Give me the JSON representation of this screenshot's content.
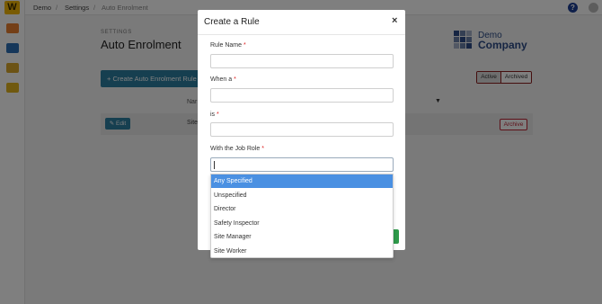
{
  "app": {
    "logo_letter": "W"
  },
  "breadcrumb": {
    "items": [
      "Demo",
      "Settings",
      "Auto Enrolment"
    ],
    "separator": "/"
  },
  "header": {
    "help_icon_glyph": "?"
  },
  "page": {
    "section_label": "SETTINGS",
    "title": "Auto Enrolment",
    "create_button_label": "+ Create Auto Enrolment Rule"
  },
  "brand": {
    "line1": "Demo",
    "line2": "Company"
  },
  "status_toggle": {
    "options": [
      "Active",
      "Archived"
    ],
    "selected": "Active"
  },
  "table": {
    "column_header": "Nar",
    "filter_icon": "▼",
    "rows": [
      {
        "edit_label": "✎ Edit",
        "name_fragment": "Site",
        "archive_label": "Archive"
      }
    ]
  },
  "modal": {
    "title": "Create a Rule",
    "close_glyph": "×",
    "required_marker": "*",
    "fields": [
      {
        "label": "Rule Name",
        "value": ""
      },
      {
        "label": "When a",
        "value": ""
      },
      {
        "label": "is",
        "value": ""
      },
      {
        "label": "With the Job Role",
        "value": ""
      }
    ]
  },
  "job_role_dropdown": {
    "options": [
      "Any Specified",
      "Unspecified",
      "Director",
      "Safety Inspector",
      "Site Manager",
      "Site Worker"
    ],
    "highlighted": "Any Specified"
  },
  "colors": {
    "primary": "#2d7fa0",
    "brand_blue": "#2c4b86",
    "highlight": "#4a90e2",
    "danger": "#bb2233",
    "success": "#2e9a4a",
    "logo_yellow": "#f2b705"
  }
}
